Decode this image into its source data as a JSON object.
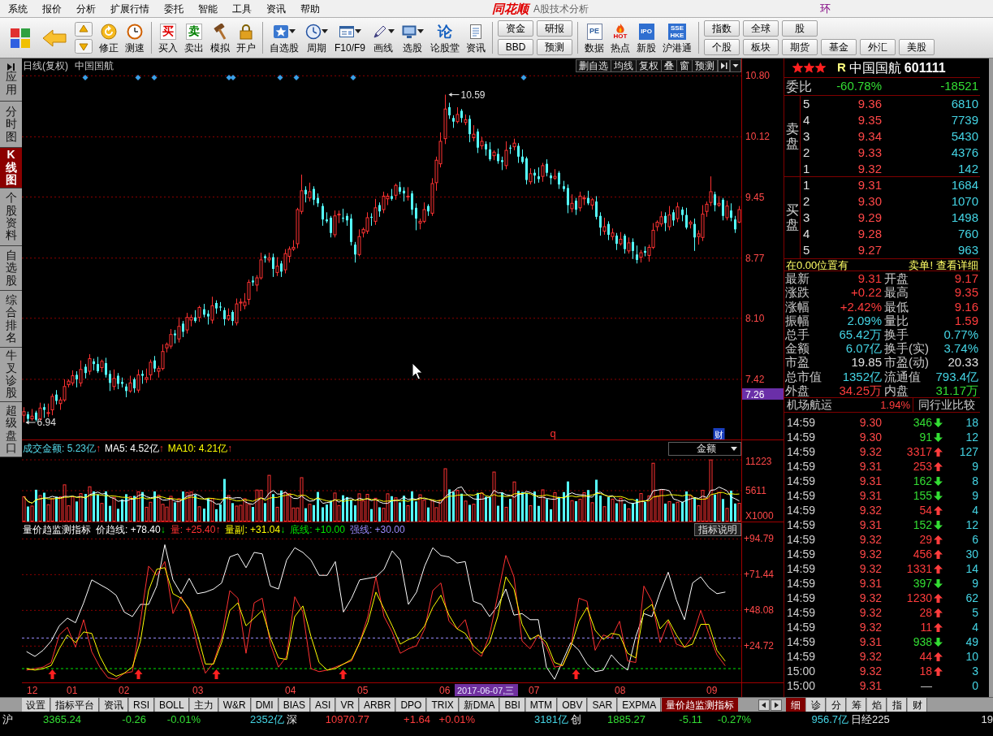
{
  "menu_bar": {
    "items": [
      "系统",
      "报价",
      "分析",
      "扩展行情",
      "委托",
      "智能",
      "工具",
      "资讯",
      "帮助"
    ],
    "logo": "同花顺",
    "title": "A股技术分析",
    "right_text": "环"
  },
  "toolbar": {
    "groups": [
      {
        "kind": "icon",
        "buttons": [
          {
            "label": "修正",
            "dropdown": false
          },
          {
            "label": "测速",
            "dropdown": false
          }
        ]
      },
      {
        "kind": "icon",
        "buttons": [
          {
            "label": "买入",
            "icon_text": "买",
            "dropdown": false
          },
          {
            "label": "卖出",
            "icon_text": "卖",
            "dropdown": false
          },
          {
            "label": "模拟",
            "dropdown": false
          },
          {
            "label": "开户",
            "dropdown": false
          }
        ]
      },
      {
        "kind": "icon",
        "buttons": [
          {
            "label": "自选股",
            "dropdown": true
          },
          {
            "label": "周期",
            "dropdown": true
          },
          {
            "label": "F10/F9",
            "dropdown": true
          },
          {
            "label": "画线",
            "dropdown": true
          },
          {
            "label": "选股",
            "dropdown": true
          },
          {
            "label": "论股堂",
            "icon_text": "论",
            "dropdown": false
          },
          {
            "label": "资讯",
            "dropdown": false
          }
        ]
      },
      {
        "kind": "stack",
        "columns": [
          {
            "top": "资金",
            "bottom": "BBD"
          },
          {
            "top": "研报",
            "bottom": "预测"
          }
        ]
      },
      {
        "kind": "icon",
        "buttons": [
          {
            "label": "数据",
            "icon_text": "PE",
            "dropdown": false
          },
          {
            "label": "热点",
            "icon_text": "HOT",
            "dropdown": false
          },
          {
            "label": "新股",
            "icon_text": "IPO",
            "dropdown": false
          },
          {
            "label": "沪港通",
            "icon_text": "SSE HKE",
            "dropdown": false
          }
        ]
      },
      {
        "kind": "stack",
        "columns": [
          {
            "top": "指数",
            "bottom": "个股"
          },
          {
            "top": "全球",
            "bottom": "板块"
          },
          {
            "top": "股",
            "bottom": "期货"
          },
          {
            "bottom": "基金"
          },
          {
            "bottom": "外汇"
          },
          {
            "bottom": "美股"
          }
        ]
      }
    ]
  },
  "side_tabs": [
    {
      "label": "应用",
      "selected": false
    },
    {
      "label": "分时图",
      "selected": false
    },
    {
      "label": "K线图",
      "selected": true
    },
    {
      "label": "个股资料",
      "selected": false
    },
    {
      "label": "自选股",
      "selected": false
    },
    {
      "label": "综合排名",
      "selected": false
    },
    {
      "label": "牛叉诊股",
      "selected": false
    },
    {
      "label": "超级盘口",
      "selected": false
    }
  ],
  "price_chart": {
    "period": "日线(复权)",
    "stock": "中国国航",
    "buttons": [
      "删自选",
      "均线",
      "复权",
      "叠",
      "窗",
      "预测"
    ],
    "high_label": "10.59",
    "low_label": "6.94",
    "cursor_price": "7.26",
    "markers": [
      {
        "text": "q",
        "kind": "plain"
      },
      {
        "text": "财",
        "kind": "boxed"
      }
    ],
    "chart_data": {
      "type": "candlestick",
      "categories": [
        null,
        null,
        null,
        null,
        null,
        null,
        null,
        null,
        null,
        null,
        null,
        null,
        null,
        null,
        null,
        null,
        null,
        null,
        null,
        null,
        null,
        null,
        null,
        null,
        null,
        null,
        null,
        null,
        null,
        null,
        null,
        null,
        null,
        null,
        null,
        null,
        null,
        null,
        null,
        null,
        null,
        null,
        null,
        null,
        null,
        null,
        null,
        null,
        null,
        null,
        null,
        null,
        null,
        null,
        null,
        null,
        null,
        null,
        null,
        null,
        null,
        null,
        null,
        null,
        null,
        null,
        null,
        null,
        null,
        null,
        null,
        null,
        null,
        null,
        null,
        null,
        null,
        null,
        null,
        null,
        null,
        null,
        null,
        null,
        null,
        null,
        null,
        null,
        null,
        null,
        null,
        null,
        null,
        null,
        null,
        null,
        null,
        null,
        null,
        null,
        null,
        null,
        null,
        null,
        null,
        null,
        null,
        null,
        null,
        null,
        null,
        null,
        null,
        null,
        null,
        null,
        null,
        null,
        null,
        null,
        null,
        null,
        null,
        null,
        null,
        null,
        null,
        null,
        null,
        null,
        null,
        null,
        null,
        null,
        null,
        null,
        null,
        null,
        null,
        null,
        null,
        null,
        null,
        null,
        null,
        null,
        null,
        null,
        null,
        null,
        null,
        null,
        null,
        null,
        null,
        null,
        null,
        null,
        null,
        null,
        null,
        null,
        null,
        null,
        null,
        null,
        null,
        null,
        null,
        null,
        null,
        null,
        null,
        null,
        null,
        null
      ],
      "ohlc": [
        [
          7.02,
          7.11,
          6.94,
          7.06
        ],
        [
          7.03,
          7.06,
          6.95,
          6.98
        ],
        [
          6.98,
          7.09,
          6.96,
          7.01
        ],
        [
          7.05,
          7.07,
          6.95,
          6.97
        ],
        [
          6.98,
          7.16,
          6.96,
          7.1
        ],
        [
          7.11,
          7.15,
          6.99,
          7.08
        ],
        [
          7.04,
          7.15,
          7.0,
          7.05
        ],
        [
          7.08,
          7.26,
          7.02,
          7.23
        ],
        [
          7.25,
          7.3,
          7.14,
          7.18
        ],
        [
          7.15,
          7.22,
          7.08,
          7.19
        ],
        [
          7.19,
          7.42,
          7.17,
          7.34
        ],
        [
          7.36,
          7.42,
          7.33,
          7.4
        ],
        [
          7.38,
          7.52,
          7.35,
          7.46
        ],
        [
          7.47,
          7.51,
          7.33,
          7.42
        ],
        [
          7.38,
          7.63,
          7.34,
          7.53
        ],
        [
          7.56,
          7.59,
          7.43,
          7.49
        ],
        [
          7.51,
          7.7,
          7.47,
          7.65
        ],
        [
          7.62,
          7.65,
          7.52,
          7.59
        ],
        [
          7.59,
          7.67,
          7.49,
          7.51
        ],
        [
          7.55,
          7.64,
          7.5,
          7.62
        ],
        [
          7.6,
          7.66,
          7.44,
          7.47
        ],
        [
          7.48,
          7.52,
          7.29,
          7.38
        ],
        [
          7.34,
          7.53,
          7.3,
          7.43
        ],
        [
          7.46,
          7.49,
          7.31,
          7.37
        ],
        [
          7.39,
          7.44,
          7.33,
          7.37
        ],
        [
          7.34,
          7.37,
          7.22,
          7.29
        ],
        [
          7.29,
          7.46,
          7.27,
          7.38
        ],
        [
          7.42,
          7.44,
          7.27,
          7.32
        ],
        [
          7.3,
          7.53,
          7.27,
          7.47
        ],
        [
          7.48,
          7.52,
          7.37,
          7.46
        ],
        [
          7.42,
          7.54,
          7.38,
          7.44
        ],
        [
          7.47,
          7.64,
          7.41,
          7.61
        ],
        [
          7.63,
          7.68,
          7.5,
          7.54
        ],
        [
          7.51,
          7.57,
          7.44,
          7.54
        ],
        [
          7.54,
          7.81,
          7.52,
          7.73
        ],
        [
          7.77,
          7.83,
          7.72,
          7.81
        ],
        [
          7.79,
          7.98,
          7.76,
          7.92
        ],
        [
          7.93,
          7.97,
          7.82,
          7.91
        ],
        [
          7.87,
          8.11,
          7.83,
          8.01
        ],
        [
          8.04,
          8.07,
          7.89,
          7.95
        ],
        [
          7.97,
          8.16,
          7.93,
          8.11
        ],
        [
          8.08,
          8.14,
          8.01,
          8.11
        ],
        [
          8.11,
          8.19,
          8.05,
          8.07
        ],
        [
          8.11,
          8.24,
          8.06,
          8.22
        ],
        [
          8.2,
          8.26,
          8.11,
          8.14
        ],
        [
          8.15,
          8.19,
          8.03,
          8.12
        ],
        [
          8.08,
          8.34,
          8.04,
          8.24
        ],
        [
          8.27,
          8.3,
          8.15,
          8.21
        ],
        [
          8.23,
          8.28,
          8.18,
          8.22
        ],
        [
          8.19,
          8.22,
          8.02,
          8.09
        ],
        [
          8.09,
          8.21,
          8.07,
          8.13
        ],
        [
          8.17,
          8.19,
          8.02,
          8.07
        ],
        [
          8.05,
          8.32,
          8.02,
          8.26
        ],
        [
          8.27,
          8.32,
          8.18,
          8.28
        ],
        [
          8.24,
          8.38,
          8.2,
          8.28
        ],
        [
          8.31,
          8.53,
          8.25,
          8.5
        ],
        [
          8.52,
          8.57,
          8.46,
          8.5
        ],
        [
          8.47,
          8.58,
          8.4,
          8.55
        ],
        [
          8.55,
          8.83,
          8.53,
          8.75
        ],
        [
          8.79,
          8.81,
          8.72,
          8.77
        ],
        [
          8.75,
          8.83,
          8.72,
          8.77
        ],
        [
          8.78,
          8.82,
          8.56,
          8.65
        ],
        [
          8.61,
          8.78,
          8.57,
          8.68
        ],
        [
          8.71,
          8.74,
          8.56,
          8.62
        ],
        [
          8.64,
          8.87,
          8.6,
          8.82
        ],
        [
          8.79,
          8.9,
          8.72,
          8.87
        ],
        [
          8.87,
          8.97,
          8.85,
          8.89
        ],
        [
          8.93,
          9.33,
          8.88,
          9.31
        ],
        [
          9.29,
          9.7,
          9.26,
          9.52
        ],
        [
          9.53,
          9.57,
          9.39,
          9.48
        ],
        [
          9.44,
          9.61,
          9.4,
          9.51
        ],
        [
          9.54,
          9.57,
          9.36,
          9.42
        ],
        [
          9.44,
          9.49,
          9.34,
          9.38
        ],
        [
          9.35,
          9.38,
          9.13,
          9.2
        ],
        [
          9.2,
          9.28,
          9.16,
          9.18
        ],
        [
          9.22,
          9.24,
          9.0,
          9.05
        ],
        [
          9.03,
          9.3,
          9.0,
          9.24
        ],
        [
          9.25,
          9.3,
          9.16,
          9.26
        ],
        [
          9.22,
          9.32,
          9.17,
          9.21
        ],
        [
          9.24,
          9.27,
          9.13,
          9.19
        ],
        [
          9.21,
          9.26,
          8.91,
          8.95
        ],
        [
          8.92,
          8.95,
          8.72,
          8.81
        ],
        [
          8.81,
          9.09,
          8.79,
          9.01
        ],
        [
          9.05,
          9.11,
          9.0,
          9.09
        ],
        [
          9.07,
          9.28,
          9.04,
          9.22
        ],
        [
          9.23,
          9.27,
          9.13,
          9.22
        ],
        [
          9.18,
          9.43,
          9.14,
          9.33
        ],
        [
          9.36,
          9.39,
          9.23,
          9.29
        ],
        [
          9.31,
          9.51,
          9.27,
          9.46
        ],
        [
          9.43,
          9.49,
          9.36,
          9.46
        ],
        [
          9.46,
          9.54,
          9.41,
          9.43
        ],
        [
          9.47,
          9.6,
          9.42,
          9.58
        ],
        [
          9.56,
          9.62,
          9.48,
          9.51
        ],
        [
          9.52,
          9.56,
          9.4,
          9.49
        ],
        [
          9.45,
          9.56,
          9.41,
          9.46
        ],
        [
          9.49,
          9.52,
          9.25,
          9.31
        ],
        [
          9.33,
          9.38,
          9.08,
          9.21
        ],
        [
          9.16,
          9.21,
          9.09,
          9.18
        ],
        [
          9.18,
          9.39,
          9.16,
          9.31
        ],
        [
          9.35,
          9.37,
          9.24,
          9.29
        ],
        [
          9.27,
          9.66,
          9.24,
          9.6
        ],
        [
          9.61,
          9.9,
          9.52,
          9.86
        ],
        [
          9.82,
          10.17,
          9.78,
          10.07
        ],
        [
          10.1,
          10.59,
          10.04,
          10.43
        ],
        [
          10.45,
          10.5,
          10.32,
          10.36
        ],
        [
          10.33,
          10.36,
          10.22,
          10.29
        ],
        [
          10.29,
          10.45,
          10.27,
          10.37
        ],
        [
          10.41,
          10.43,
          10.28,
          10.33
        ],
        [
          10.28,
          10.37,
          10.25,
          10.31
        ],
        [
          10.32,
          10.36,
          10.06,
          10.15
        ],
        [
          10.11,
          10.25,
          10.07,
          10.15
        ],
        [
          10.18,
          10.21,
          9.94,
          10.0
        ],
        [
          10.02,
          10.12,
          9.98,
          10.07
        ],
        [
          10.04,
          10.07,
          9.91,
          9.98
        ],
        [
          9.98,
          10.06,
          9.85,
          9.87
        ],
        [
          9.91,
          9.97,
          9.86,
          9.95
        ],
        [
          9.93,
          9.99,
          9.82,
          9.85
        ],
        [
          9.86,
          9.9,
          9.75,
          9.84
        ],
        [
          9.8,
          10.07,
          9.76,
          9.97
        ],
        [
          10.0,
          10.03,
          9.93,
          9.99
        ],
        [
          10.01,
          10.1,
          9.97,
          10.05
        ],
        [
          10.02,
          10.05,
          9.83,
          9.9
        ],
        [
          9.9,
          9.98,
          9.82,
          9.84
        ],
        [
          9.88,
          9.9,
          9.59,
          9.64
        ],
        [
          9.62,
          9.77,
          9.59,
          9.71
        ],
        [
          9.72,
          9.76,
          9.6,
          9.69
        ],
        [
          9.68,
          9.78,
          9.61,
          9.65
        ],
        [
          9.68,
          9.83,
          9.62,
          9.8
        ],
        [
          9.82,
          9.87,
          9.68,
          9.72
        ],
        [
          9.69,
          9.72,
          9.59,
          9.66
        ],
        [
          9.66,
          9.76,
          9.64,
          9.68
        ],
        [
          9.72,
          9.74,
          9.54,
          9.59
        ],
        [
          9.57,
          9.63,
          9.51,
          9.54
        ],
        [
          9.55,
          9.59,
          9.27,
          9.36
        ],
        [
          9.32,
          9.48,
          9.28,
          9.38
        ],
        [
          9.41,
          9.44,
          9.25,
          9.31
        ],
        [
          9.33,
          9.51,
          9.29,
          9.46
        ],
        [
          9.43,
          9.47,
          9.36,
          9.44
        ],
        [
          9.44,
          9.52,
          9.36,
          9.38
        ],
        [
          9.36,
          9.44,
          9.31,
          9.42
        ],
        [
          9.4,
          9.46,
          9.2,
          9.23
        ],
        [
          9.24,
          9.28,
          9.02,
          9.11
        ],
        [
          9.07,
          9.22,
          9.03,
          9.12
        ],
        [
          9.15,
          9.18,
          8.97,
          9.03
        ],
        [
          9.01,
          9.1,
          8.97,
          9.05
        ],
        [
          9.02,
          9.05,
          8.86,
          8.93
        ],
        [
          8.93,
          9.06,
          8.91,
          8.98
        ],
        [
          9.02,
          9.04,
          8.82,
          8.87
        ],
        [
          8.85,
          9.0,
          8.82,
          8.94
        ],
        [
          8.95,
          8.99,
          8.76,
          8.85
        ],
        [
          8.81,
          8.91,
          8.71,
          8.75
        ],
        [
          8.78,
          8.86,
          8.72,
          8.83
        ],
        [
          8.85,
          8.9,
          8.79,
          8.83
        ],
        [
          8.8,
          8.92,
          8.73,
          8.89
        ],
        [
          8.89,
          9.16,
          8.87,
          9.08
        ],
        [
          9.12,
          9.19,
          9.07,
          9.17
        ],
        [
          9.15,
          9.29,
          9.12,
          9.23
        ],
        [
          9.24,
          9.28,
          9.07,
          9.16
        ],
        [
          9.12,
          9.35,
          9.08,
          9.25
        ],
        [
          9.28,
          9.31,
          9.13,
          9.19
        ],
        [
          9.21,
          9.39,
          9.17,
          9.34
        ],
        [
          9.31,
          9.34,
          9.18,
          9.25
        ],
        [
          9.25,
          9.33,
          9.09,
          9.11
        ],
        [
          9.15,
          9.19,
          9.1,
          9.17
        ],
        [
          9.15,
          9.21,
          8.85,
          9.0
        ],
        [
          9.01,
          9.08,
          8.92,
          9.04
        ],
        [
          9.0,
          9.36,
          8.96,
          9.26
        ],
        [
          9.29,
          9.4,
          9.23,
          9.37
        ],
        [
          9.39,
          9.68,
          9.35,
          9.51
        ],
        [
          9.48,
          9.51,
          9.29,
          9.36
        ],
        [
          9.36,
          9.46,
          9.34,
          9.38
        ],
        [
          9.42,
          9.44,
          9.19,
          9.24
        ],
        [
          9.22,
          9.41,
          9.19,
          9.35
        ],
        [
          9.3,
          9.38,
          9.18,
          9.22
        ],
        [
          9.2,
          9.24,
          9.05,
          9.09
        ],
        [
          9.17,
          9.35,
          9.16,
          9.31
        ]
      ],
      "ylim": [
        6.75,
        10.83
      ],
      "yticks": [
        {
          "value": 10.8,
          "label": "10.80"
        },
        {
          "value": 10.12,
          "label": "10.12"
        },
        {
          "value": 9.45,
          "label": "9.45"
        },
        {
          "value": 8.77,
          "label": "8.77"
        },
        {
          "value": 8.1,
          "label": "8.10"
        },
        {
          "value": 7.42,
          "label": "7.42"
        }
      ],
      "grid": true
    }
  },
  "volume_chart": {
    "legend": [
      {
        "text": "成交金额: 5.23亿",
        "arrow": "↑",
        "kind": "up"
      },
      {
        "text": "MA5: 4.52亿",
        "arrow": "↑",
        "kind": "up",
        "color": "#ffffff"
      },
      {
        "text": "MA10: 4.21亿",
        "arrow": "↑",
        "kind": "up",
        "color": "#ffff00"
      }
    ],
    "selector": "金额",
    "axis_labels": [
      "11223",
      "5611",
      "X1000"
    ]
  },
  "indicator_chart": {
    "title": "量价趋监测指标",
    "legend": [
      {
        "text": "价趋线: +78.40",
        "arrow": "↓",
        "kind": "down"
      },
      {
        "text": "量: +25.40",
        "arrow": "↑",
        "kind": "up"
      },
      {
        "text": "量副: +31.04",
        "arrow": "↓",
        "kind": "down"
      }
    ],
    "help_button": "指标说明",
    "chart_data": {
      "type": "line",
      "series": [
        {
          "color": "#ffffff",
          "values": [
            21,
            18,
            22,
            28,
            38,
            43,
            40,
            53,
            68,
            65,
            62,
            58,
            47,
            44,
            52,
            52,
            64,
            91,
            68,
            59,
            69,
            59,
            60,
            62,
            66,
            83,
            85,
            76,
            86,
            85,
            64,
            62,
            81,
            89,
            86,
            81,
            71,
            71,
            80,
            47,
            56,
            68,
            69,
            70,
            75,
            87,
            81,
            52,
            60,
            77,
            89,
            84,
            83,
            79,
            80,
            54,
            52,
            44,
            51,
            62,
            45,
            46,
            42,
            42,
            11,
            3,
            15,
            27,
            22,
            13,
            8,
            9,
            19,
            13,
            9,
            31,
            46,
            44,
            60,
            73,
            55,
            42,
            66,
            70,
            63,
            59,
            60
          ]
        },
        {
          "color": "#ff3232",
          "values": [
            9,
            10,
            11,
            14,
            32,
            37,
            24,
            42,
            21,
            11,
            4,
            3,
            7,
            8,
            41,
            77,
            71,
            80,
            46,
            57,
            48,
            25,
            7,
            14,
            30,
            61,
            56,
            20,
            53,
            56,
            26,
            11,
            18,
            57,
            47,
            10,
            8,
            9,
            11,
            13,
            15,
            27,
            44,
            70,
            44,
            34,
            20,
            23,
            25,
            36,
            61,
            66,
            41,
            36,
            42,
            22,
            18,
            32,
            58,
            84,
            70,
            28,
            23,
            32,
            24,
            11,
            12,
            24,
            56,
            54,
            22,
            32,
            30,
            41,
            15,
            14,
            64,
            54,
            27,
            41,
            26,
            24,
            31,
            48,
            33,
            19,
            12
          ]
        },
        {
          "color": "#ffff00",
          "values": [
            10,
            9,
            10,
            12,
            23,
            32,
            27,
            34,
            33,
            18,
            8,
            5,
            7,
            11,
            28,
            61,
            75,
            76,
            59,
            56,
            49,
            33,
            13,
            13,
            27,
            48,
            53,
            38,
            43,
            48,
            30,
            17,
            16,
            44,
            51,
            31,
            14,
            9,
            10,
            13,
            16,
            27,
            40,
            60,
            49,
            38,
            26,
            29,
            31,
            38,
            50,
            58,
            45,
            36,
            33,
            25,
            20,
            27,
            44,
            70,
            62,
            39,
            29,
            32,
            27,
            14,
            12,
            24,
            41,
            50,
            35,
            29,
            33,
            32,
            20,
            17,
            48,
            52,
            36,
            42,
            32,
            24,
            26,
            39,
            39,
            22,
            15
          ]
        }
      ],
      "ylim": [
        1,
        96.6
      ],
      "yticks": [
        {
          "value": 94.79,
          "label": "+94.79"
        },
        {
          "value": 71.44,
          "label": "+71.44"
        },
        {
          "value": 48.08,
          "label": "+48.08"
        },
        {
          "value": 24.72,
          "label": "+24.72"
        }
      ],
      "grid": true,
      "ref_lines": [
        {
          "axis": "y",
          "value": 10,
          "label": "底线: +10.00",
          "color": "#00e600"
        },
        {
          "axis": "y",
          "value": 30,
          "label": "强线: +30.00",
          "color": "#9c8cff"
        }
      ]
    }
  },
  "date_axis": {
    "labels": [
      "12",
      "01",
      "02",
      "03",
      "04",
      "05",
      "06",
      "07",
      "08",
      "09"
    ],
    "cursor_date": "2017-06-07,三"
  },
  "quote": {
    "stars": 3,
    "flag": "R",
    "name": "中国国航",
    "code": "601111",
    "ratio": {
      "label": "委比",
      "percent": "-60.78%",
      "diff": "-18521",
      "kind": "down"
    },
    "asks_label": "卖盘",
    "asks": [
      {
        "level": "5",
        "price": "9.36",
        "volume": "6810"
      },
      {
        "level": "4",
        "price": "9.35",
        "volume": "7739"
      },
      {
        "level": "3",
        "price": "9.34",
        "volume": "5430"
      },
      {
        "level": "2",
        "price": "9.33",
        "volume": "4376"
      },
      {
        "level": "1",
        "price": "9.32",
        "volume": "142"
      }
    ],
    "bids_label": "买盘",
    "bids": [
      {
        "level": "1",
        "price": "9.31",
        "volume": "1684"
      },
      {
        "level": "2",
        "price": "9.30",
        "volume": "1070"
      },
      {
        "level": "3",
        "price": "9.29",
        "volume": "1498"
      },
      {
        "level": "4",
        "price": "9.28",
        "volume": "760"
      },
      {
        "level": "5",
        "price": "9.27",
        "volume": "963"
      }
    ],
    "notice": {
      "left": "在0.00位置有",
      "right": "卖单!",
      "link": "查看详细"
    },
    "stats": [
      [
        {
          "label": "最新",
          "value": "9.31",
          "kind": "up"
        },
        {
          "label": "开盘",
          "value": "9.17",
          "kind": "up"
        }
      ],
      [
        {
          "label": "涨跌",
          "value": "+0.22",
          "kind": "up"
        },
        {
          "label": "最高",
          "value": "9.35",
          "kind": "up"
        }
      ],
      [
        {
          "label": "涨幅",
          "value": "+2.42%",
          "kind": "up"
        },
        {
          "label": "最低",
          "value": "9.16",
          "kind": "up"
        }
      ],
      [
        {
          "label": "振幅",
          "value": "2.09%",
          "kind": "info"
        },
        {
          "label": "量比",
          "value": "1.59",
          "kind": "up"
        }
      ],
      [
        {
          "label": "总手",
          "value": "65.42万",
          "kind": "info"
        },
        {
          "label": "换手",
          "value": "0.77%",
          "kind": "info"
        }
      ],
      [
        {
          "label": "金额",
          "value": "6.07亿",
          "kind": "info"
        },
        {
          "label": "换手(实)",
          "value": "3.74%",
          "kind": "info"
        }
      ],
      [
        {
          "label": "市盈",
          "value": "19.85",
          "kind": "plain"
        },
        {
          "label": "市盈(动)",
          "value": "20.33",
          "kind": "plain"
        }
      ],
      [
        {
          "label": "总市值",
          "value": "1352亿",
          "kind": "info"
        },
        {
          "label": "流通值",
          "value": "793.4亿",
          "kind": "info"
        }
      ],
      [
        {
          "label": "外盘",
          "value": "34.25万",
          "kind": "up"
        },
        {
          "label": "内盘",
          "value": "31.17万",
          "kind": "down"
        }
      ]
    ],
    "industry": {
      "name": "机场航运",
      "change": "1.94%",
      "kind": "up",
      "button": "同行业比较"
    },
    "ticks": [
      {
        "time": "14:59",
        "price": "9.30",
        "volume": "346",
        "kind": "down",
        "count": "18"
      },
      {
        "time": "14:59",
        "price": "9.30",
        "volume": "91",
        "kind": "down",
        "count": "12"
      },
      {
        "time": "14:59",
        "price": "9.32",
        "volume": "3317",
        "kind": "up",
        "count": "127"
      },
      {
        "time": "14:59",
        "price": "9.31",
        "volume": "253",
        "kind": "up",
        "count": "9"
      },
      {
        "time": "14:59",
        "price": "9.31",
        "volume": "162",
        "kind": "down",
        "count": "8"
      },
      {
        "time": "14:59",
        "price": "9.31",
        "volume": "155",
        "kind": "down",
        "count": "9"
      },
      {
        "time": "14:59",
        "price": "9.32",
        "volume": "54",
        "kind": "up",
        "count": "4"
      },
      {
        "time": "14:59",
        "price": "9.31",
        "volume": "152",
        "kind": "down",
        "count": "12"
      },
      {
        "time": "14:59",
        "price": "9.32",
        "volume": "29",
        "kind": "up",
        "count": "6"
      },
      {
        "time": "14:59",
        "price": "9.32",
        "volume": "456",
        "kind": "up",
        "count": "30"
      },
      {
        "time": "14:59",
        "price": "9.32",
        "volume": "1331",
        "kind": "up",
        "count": "14"
      },
      {
        "time": "14:59",
        "price": "9.31",
        "volume": "397",
        "kind": "down",
        "count": "9"
      },
      {
        "time": "14:59",
        "price": "9.32",
        "volume": "1230",
        "kind": "up",
        "count": "62"
      },
      {
        "time": "14:59",
        "price": "9.32",
        "volume": "28",
        "kind": "up",
        "count": "5"
      },
      {
        "time": "14:59",
        "price": "9.32",
        "volume": "11",
        "kind": "up",
        "count": "4"
      },
      {
        "time": "14:59",
        "price": "9.31",
        "volume": "938",
        "kind": "down",
        "count": "49"
      },
      {
        "time": "14:59",
        "price": "9.32",
        "volume": "44",
        "kind": "up",
        "count": "10"
      },
      {
        "time": "15:00",
        "price": "9.32",
        "volume": "18",
        "kind": "up",
        "count": "3"
      },
      {
        "time": "15:00",
        "price": "9.31",
        "volume": "—",
        "kind": "flat",
        "count": "0"
      }
    ]
  },
  "bottom_tabs": {
    "tabs": [
      {
        "label": "设置",
        "selected": false
      },
      {
        "label": "指标平台",
        "selected": false
      },
      {
        "label": "资讯",
        "selected": false
      },
      {
        "label": "RSI",
        "selected": false
      },
      {
        "label": "BOLL",
        "selected": false
      },
      {
        "label": "主力",
        "selected": false
      },
      {
        "label": "W&R",
        "selected": false
      },
      {
        "label": "DMI",
        "selected": false
      },
      {
        "label": "BIAS",
        "selected": false
      },
      {
        "label": "ASI",
        "selected": false
      },
      {
        "label": "VR",
        "selected": false
      },
      {
        "label": "ARBR",
        "selected": false
      },
      {
        "label": "DPO",
        "selected": false
      },
      {
        "label": "TRIX",
        "selected": false
      },
      {
        "label": "新DMA",
        "selected": false
      },
      {
        "label": "BBI",
        "selected": false
      },
      {
        "label": "MTM",
        "selected": false
      },
      {
        "label": "OBV",
        "selected": false
      },
      {
        "label": "SAR",
        "selected": false
      },
      {
        "label": "EXPMA",
        "selected": false
      },
      {
        "label": "量价趋监测指标",
        "selected": true
      }
    ],
    "side_tabs": [
      {
        "label": "细",
        "selected": true
      },
      {
        "label": "诊",
        "selected": false
      },
      {
        "label": "分",
        "selected": false
      },
      {
        "label": "筹",
        "selected": false
      },
      {
        "label": "焰",
        "selected": false
      },
      {
        "label": "指",
        "selected": false
      },
      {
        "label": "财",
        "selected": false
      }
    ]
  },
  "status_bar": [
    {
      "text": "沪",
      "kind": "label"
    },
    {
      "text": "3365.24",
      "kind": "down"
    },
    {
      "text": "-0.26",
      "kind": "down"
    },
    {
      "text": "-0.01%",
      "kind": "down"
    },
    {
      "text": "2352亿",
      "kind": "amount"
    },
    {
      "text": "深",
      "kind": "label"
    },
    {
      "text": "10970.77",
      "kind": "up"
    },
    {
      "text": "+1.64",
      "kind": "up"
    },
    {
      "text": "+0.01%",
      "kind": "up"
    },
    {
      "text": "3181亿",
      "kind": "amount"
    },
    {
      "text": "创",
      "kind": "label"
    },
    {
      "text": "1885.27",
      "kind": "down"
    },
    {
      "text": "-5.11",
      "kind": "down"
    },
    {
      "text": "-0.27%",
      "kind": "down"
    },
    {
      "text": "956.7亿",
      "kind": "amount"
    },
    {
      "text": "日经225",
      "kind": "label"
    },
    {
      "text": "19",
      "kind": "plain"
    }
  ]
}
